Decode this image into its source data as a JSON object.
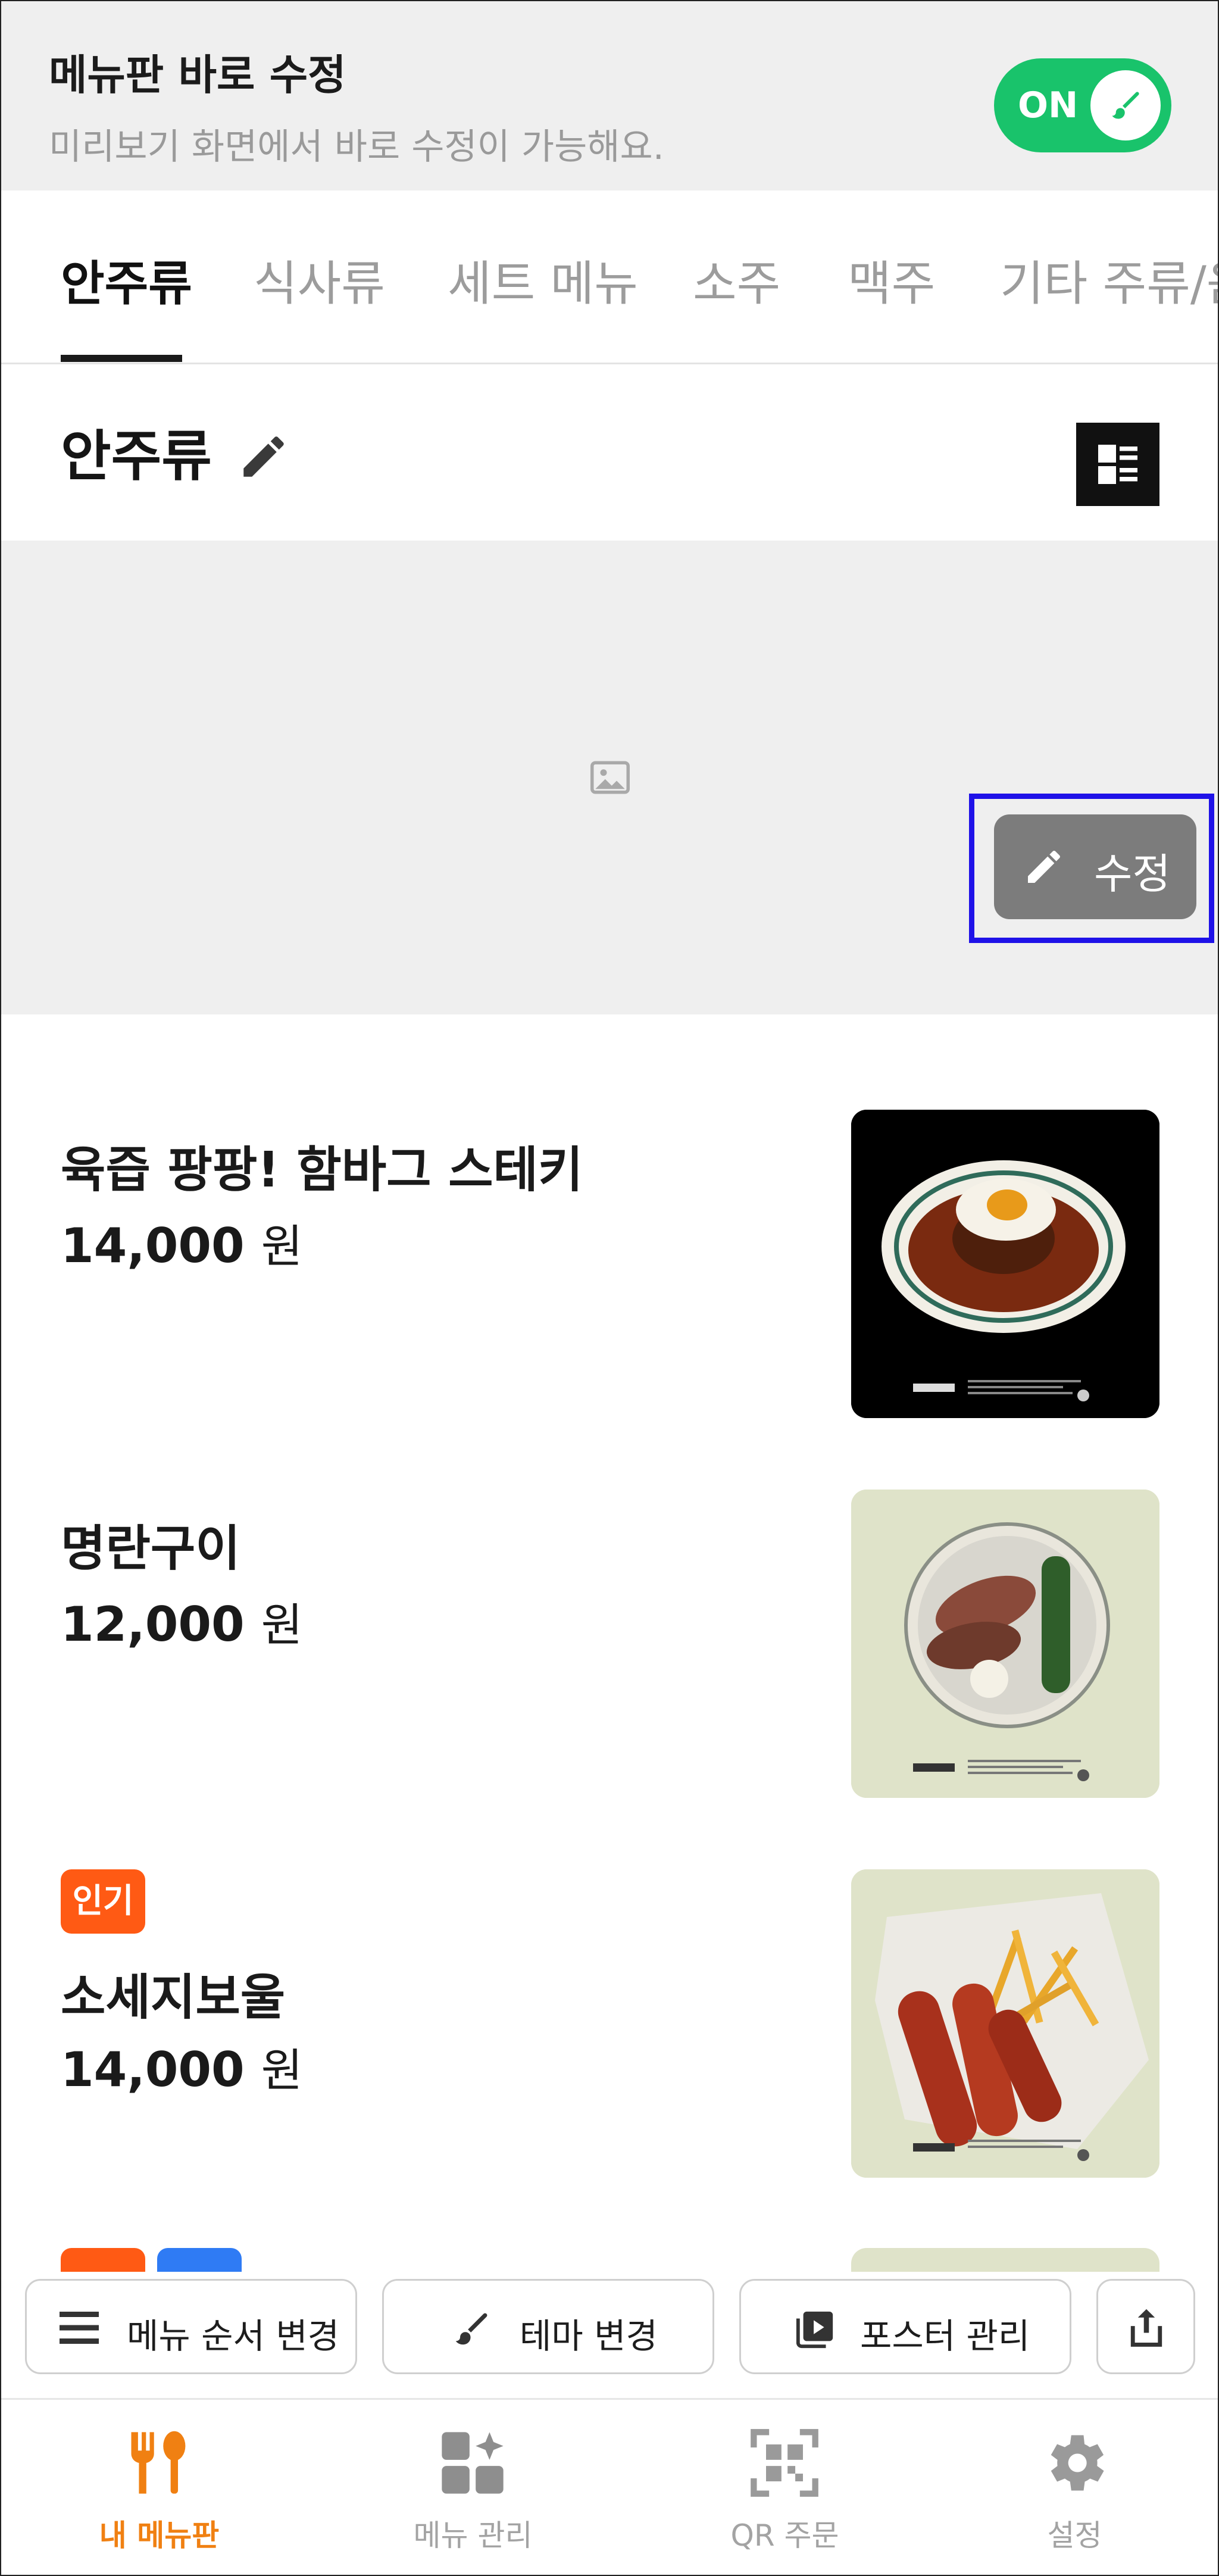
{
  "banner": {
    "title": "메뉴판 바로 수정",
    "subtitle": "미리보기 화면에서 바로 수정이 가능해요.",
    "toggle_label": "ON"
  },
  "tabs": [
    {
      "label": "안주류",
      "active": true
    },
    {
      "label": "식사류"
    },
    {
      "label": "세트 메뉴"
    },
    {
      "label": "소주"
    },
    {
      "label": "맥주"
    },
    {
      "label": "기타 주류/음"
    }
  ],
  "section": {
    "title": "안주류"
  },
  "edit_button": {
    "label": "수정"
  },
  "items": [
    {
      "name": "육즙 팡팡! 함바그 스테키",
      "price": "14,000",
      "currency": "원"
    },
    {
      "name": "명란구이",
      "price": "12,000",
      "currency": "원"
    },
    {
      "name": "소세지보울",
      "price": "14,000",
      "currency": "원",
      "badge": "인기"
    }
  ],
  "actions": {
    "reorder": "메뉴 순서 변경",
    "theme": "테마 변경",
    "poster": "포스터 관리"
  },
  "nav": [
    {
      "label": "내 메뉴판",
      "icon": "fork-spoon-icon",
      "active": true
    },
    {
      "label": "메뉴 관리",
      "icon": "grid-sparkle-icon"
    },
    {
      "label": "QR 주문",
      "icon": "qr-icon"
    },
    {
      "label": "설정",
      "icon": "gear-icon"
    }
  ],
  "colors": {
    "toggle_on": "#19c36b",
    "accent_nav": "#f08012",
    "badge_popular": "#ff5a14",
    "highlight": "#1f12e8"
  }
}
